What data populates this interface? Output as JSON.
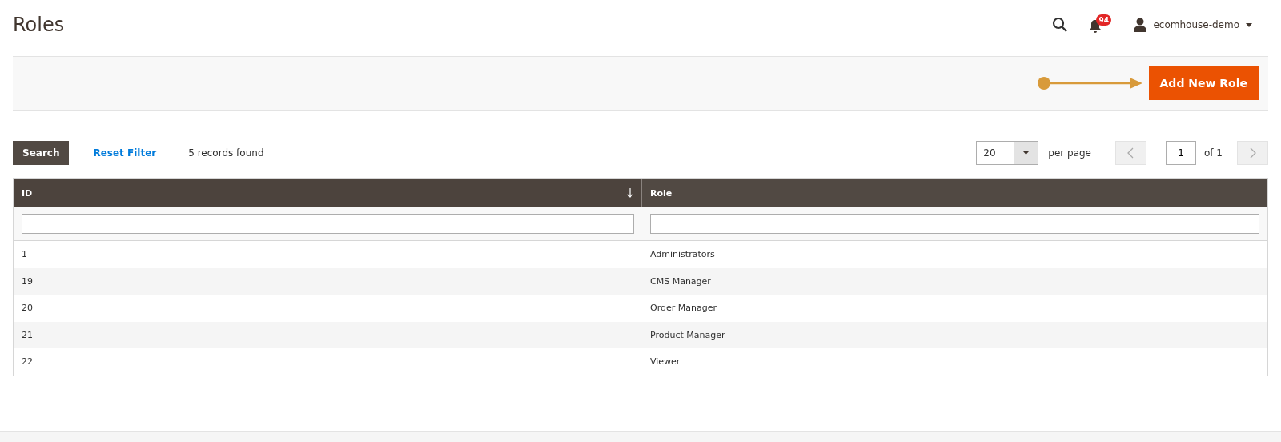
{
  "page_title": "Roles",
  "header": {
    "notifications": "94",
    "user": "ecomhouse-demo"
  },
  "action_button": "Add New Role",
  "grid_controls": {
    "search_button": "Search",
    "reset_link": "Reset Filter",
    "records": "5 records found",
    "page_size": "20",
    "per_page_label": "per page",
    "page": "1",
    "page_total": "of 1"
  },
  "table": {
    "columns": [
      {
        "label": "ID",
        "sorted": true
      },
      {
        "label": "Role",
        "sorted": false
      }
    ],
    "rows": [
      {
        "id": "1",
        "role": "Administrators"
      },
      {
        "id": "19",
        "role": "CMS Manager"
      },
      {
        "id": "20",
        "role": "Order Manager"
      },
      {
        "id": "21",
        "role": "Product Manager"
      },
      {
        "id": "22",
        "role": "Viewer"
      }
    ]
  }
}
